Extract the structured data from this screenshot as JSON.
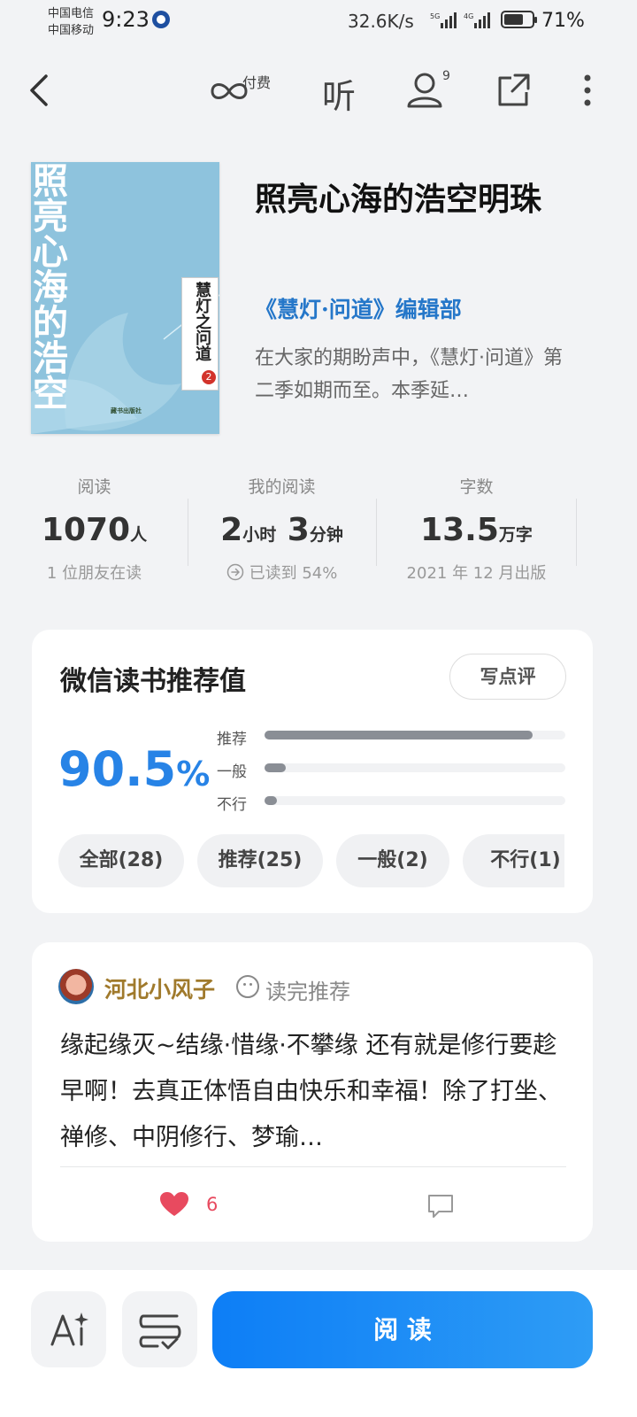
{
  "status_bar": {
    "carrier1": "中国电信",
    "carrier2": "中国移动",
    "time": "9:23",
    "net_speed": "32.6K/s",
    "signal1_tag": "5G",
    "signal2_tag": "4G",
    "battery": "71%",
    "battery_level": 0.71
  },
  "nav": {
    "paid_label": "付费",
    "listen_label": "听",
    "friends_count": "9"
  },
  "book": {
    "cover_title": "照亮心海的浩空明珠",
    "cover_series": "慧灯之问道",
    "cover_series_num": "2",
    "cover_publisher": "藏书出版社",
    "title": "照亮心海的浩空明珠",
    "author": "《慧灯·问道》编辑部",
    "intro": "在大家的期盼声中，《慧灯·问道》第二季如期而至。本季延…"
  },
  "stats": [
    {
      "label": "阅读",
      "value": "1070",
      "unit": "人",
      "sub": "1 位朋友在读"
    },
    {
      "label": "我的阅读",
      "value_a": "2",
      "unit_a": "小时",
      "value_b": "3",
      "unit_b": "分钟",
      "sub": "已读到 54%"
    },
    {
      "label": "字数",
      "value": "13.5",
      "unit": "万字",
      "sub": "2021 年 12 月出版"
    }
  ],
  "rating": {
    "title": "微信读书推荐值",
    "write_button": "写点评",
    "score": "90.5",
    "score_unit": "%",
    "bars": [
      {
        "label": "推荐",
        "fraction": 0.89
      },
      {
        "label": "一般",
        "fraction": 0.07
      },
      {
        "label": "不行",
        "fraction": 0.04
      }
    ],
    "filters": [
      "全部(28)",
      "推荐(25)",
      "一般(2)",
      "不行(1)"
    ]
  },
  "review": {
    "user": "河北小风子",
    "tag": "读完推荐",
    "text": "缘起缘灭~结缘·惜缘·不攀缘 还有就是修行要趁早啊！去真正体悟自由快乐和幸福！除了打坐、禅修、中阴修行、梦瑜…",
    "likes": "6"
  },
  "bottom": {
    "read_button": "阅 读"
  },
  "colors": {
    "accent": "#2783e6",
    "author": "#2577c9",
    "reviewer": "#a07a2c",
    "like": "#e84a5f",
    "cover": "#8ec3dd"
  },
  "icons": [
    "back-icon",
    "infinity-icon",
    "listen-icon",
    "friends-icon",
    "share-icon",
    "more-icon",
    "progress-arrow-icon",
    "smile-icon",
    "heart-icon",
    "comment-icon",
    "ai-icon",
    "notes-icon"
  ]
}
